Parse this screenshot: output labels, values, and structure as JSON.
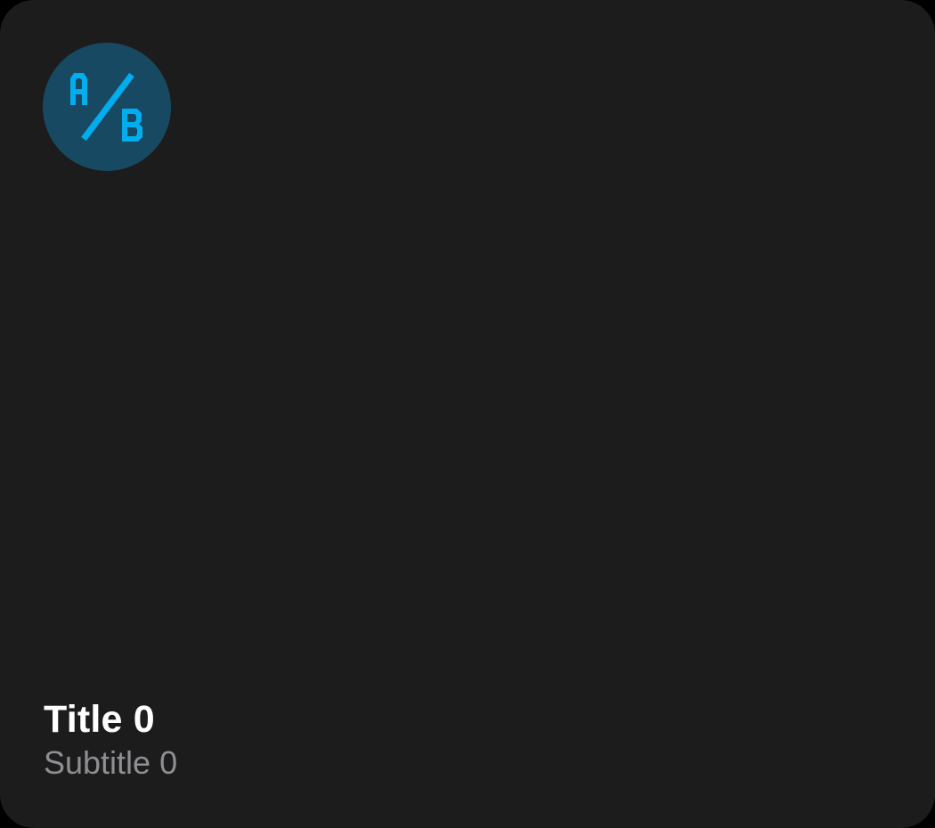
{
  "card": {
    "icon": "ab-test-icon",
    "icon_letters": [
      "A",
      "B"
    ],
    "accent_color": "#00aef0",
    "icon_background": "#174a62",
    "title": "Title 0",
    "subtitle": "Subtitle 0"
  }
}
